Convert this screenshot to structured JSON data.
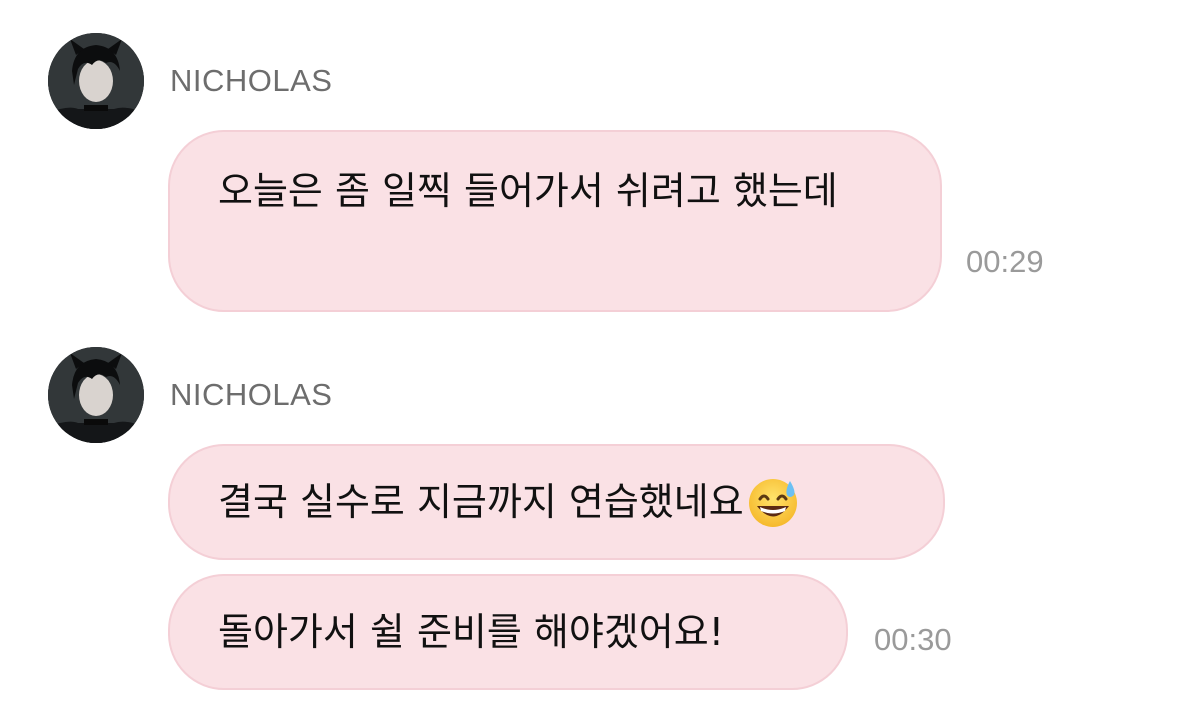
{
  "conversation": {
    "messages": [
      {
        "sender": "NICHOLAS",
        "avatar_icon": "profile-photo-avatar",
        "bubbles": [
          {
            "text": "오늘은 좀 일찍 들어가서 쉬려고 했는데"
          }
        ],
        "time": "00:29"
      },
      {
        "sender": "NICHOLAS",
        "avatar_icon": "profile-photo-avatar",
        "bubbles": [
          {
            "text": "결국 실수로 지금까지 연습했네요",
            "emoji": "grinning-face-with-sweat-emoji"
          },
          {
            "text": "돌아가서 쉴 준비를 해야겠어요!"
          }
        ],
        "time": "00:30"
      }
    ]
  },
  "colors": {
    "bubble_background": "#fae1e5",
    "bubble_border": "#f4cfd6",
    "sender_text": "#6d6d6d",
    "timestamp_text": "#9a9a9a"
  }
}
